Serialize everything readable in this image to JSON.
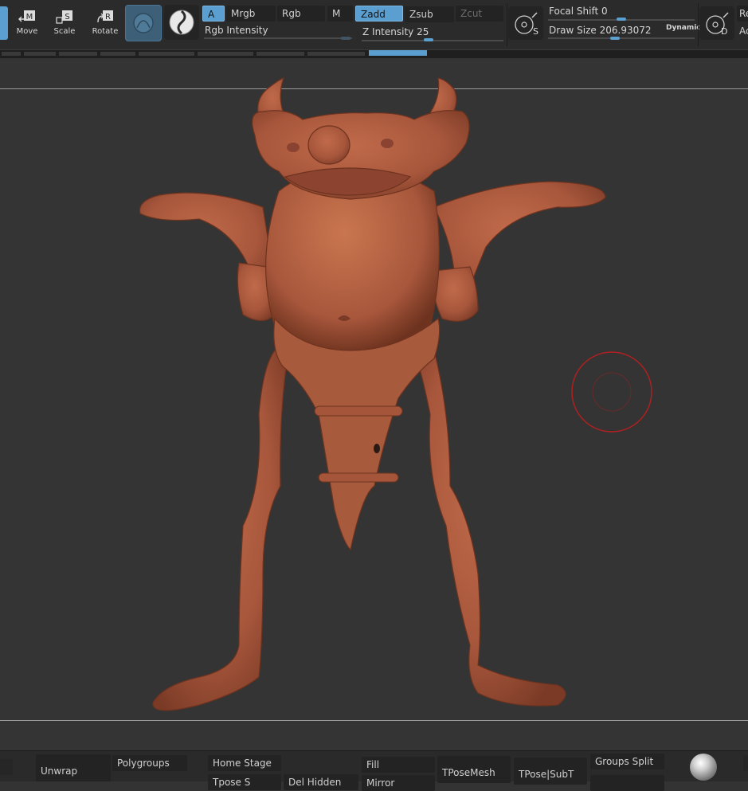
{
  "toolbar": {
    "move_label": "Move",
    "move_key": "M",
    "scale_label": "Scale",
    "scale_key": "S",
    "rotate_label": "Rotate",
    "rotate_key": "R",
    "a_label": "A",
    "mrgb_label": "Mrgb",
    "rgb_label": "Rgb",
    "m_label": "M",
    "zadd_label": "Zadd",
    "zsub_label": "Zsub",
    "zcut_label": "Zcut",
    "rgb_intensity_label": "Rgb Intensity",
    "z_intensity_label": "Z Intensity",
    "z_intensity_value": "25",
    "focal_shift_label": "Focal Shift",
    "focal_shift_value": "0",
    "draw_size_label": "Draw Size",
    "draw_size_value": "206.93072",
    "dynamic_label": "Dynamic",
    "lsym_key": "S",
    "draw_key": "D",
    "right_cut_1": "Re",
    "right_cut_2": "Ac"
  },
  "bottom": {
    "unwrap": "Unwrap",
    "polygroups": "Polygroups",
    "home_stage": "Home Stage",
    "fill": "Fill",
    "tposemesh": "TPoseMesh",
    "tpose_subt": "TPose|SubT",
    "groups_split": "Groups Split",
    "truncated_1": "Tpose S",
    "truncated_2": "Del Hidden",
    "truncated_3": "Mirror"
  },
  "colors": {
    "accent": "#5a9fd0",
    "model": "#a8573c",
    "brush_ring": "#b02020"
  }
}
